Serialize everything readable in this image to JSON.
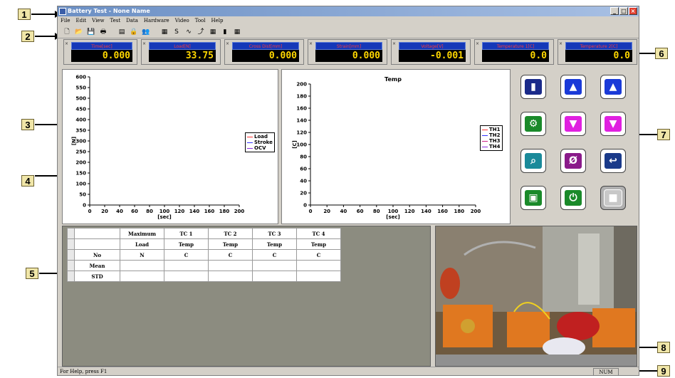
{
  "window": {
    "title": "Battery Test - None Name"
  },
  "menu": [
    "File",
    "Edit",
    "View",
    "Test",
    "Data",
    "Hardware",
    "Video",
    "Tool",
    "Help"
  ],
  "toolbar": [
    "new-icon",
    "open-icon",
    "save-icon",
    "print-icon",
    "table-icon",
    "lock-icon",
    "people-icon",
    "chart-icon",
    "s-icon",
    "curve-icon",
    "curve2-icon",
    "grid-icon",
    "bar-icon",
    "calendar-icon"
  ],
  "meters": [
    {
      "label": "Time[sec]",
      "value": "0.000"
    },
    {
      "label": "Load[N]",
      "value": "33.75"
    },
    {
      "label": "Cross Dist[mm]",
      "value": "0.000"
    },
    {
      "label": "Strain[mm]",
      "value": "0.000"
    },
    {
      "label": "Voltage[V]",
      "value": "-0.001"
    },
    {
      "label": "Temperature 1[C]",
      "value": "0.0"
    },
    {
      "label": "Temperature 2[C]",
      "value": "0.0"
    }
  ],
  "chart_data": [
    {
      "type": "line",
      "title": "",
      "xlabel": "[sec]",
      "ylabel": "[N]",
      "xlim": [
        0,
        200
      ],
      "ylim": [
        0,
        600
      ],
      "x_ticks": [
        0,
        20,
        40,
        60,
        80,
        100,
        120,
        140,
        160,
        180,
        200
      ],
      "y_ticks": [
        0,
        50,
        100,
        150,
        200,
        250,
        300,
        350,
        400,
        450,
        500,
        550,
        600
      ],
      "series": [
        {
          "name": "Load",
          "color": "#ff3333",
          "values": []
        },
        {
          "name": "Stroke",
          "color": "#3333ff",
          "values": []
        },
        {
          "name": "OCV",
          "color": "#8a2be2",
          "values": []
        }
      ],
      "legend": "right"
    },
    {
      "type": "line",
      "title": "Temp",
      "xlabel": "[sec]",
      "ylabel": "[C]",
      "xlim": [
        0,
        200
      ],
      "ylim": [
        0,
        200
      ],
      "x_ticks": [
        0,
        20,
        40,
        60,
        80,
        100,
        120,
        140,
        160,
        180,
        200
      ],
      "y_ticks": [
        0,
        20,
        40,
        60,
        80,
        100,
        120,
        140,
        160,
        180,
        200
      ],
      "series": [
        {
          "name": "TH1",
          "color": "#ff3333",
          "values": []
        },
        {
          "name": "TH2",
          "color": "#3333ff",
          "values": []
        },
        {
          "name": "TH3",
          "color": "#cc2288",
          "values": []
        },
        {
          "name": "TH4",
          "color": "#8a2be2",
          "values": []
        }
      ],
      "legend": "right"
    }
  ],
  "controls": [
    {
      "name": "battery-button",
      "bg": "#1a2a8a",
      "glyph": "▮"
    },
    {
      "name": "up-button",
      "bg": "#1a3ad8",
      "glyph": "▲"
    },
    {
      "name": "fast-up-button",
      "bg": "#1a3ad8",
      "glyph": "▲"
    },
    {
      "name": "settings-button",
      "bg": "#1a8a2a",
      "glyph": "⚙"
    },
    {
      "name": "down-button",
      "bg": "#e020e0",
      "glyph": "▼"
    },
    {
      "name": "fast-down-button",
      "bg": "#e020e0",
      "glyph": "▼"
    },
    {
      "name": "zoom-button",
      "bg": "#1a8a9a",
      "glyph": "⌕"
    },
    {
      "name": "zero-button",
      "bg": "#8a1a8a",
      "glyph": "Ø"
    },
    {
      "name": "return-button",
      "bg": "#1a3a8a",
      "glyph": "↩"
    },
    {
      "name": "record-button",
      "bg": "#1a8a2a",
      "glyph": "▣"
    },
    {
      "name": "power-button",
      "bg": "#1a8a2a",
      "glyph": "⏻"
    },
    {
      "name": "stop-button",
      "bg": "#c8c8c8",
      "glyph": "■"
    }
  ],
  "stats_table": {
    "headers": [
      "Maximum",
      "TC 1",
      "TC 2",
      "TC 3",
      "TC 4"
    ],
    "subheaders": [
      "Load",
      "Temp",
      "Temp",
      "Temp",
      "Temp"
    ],
    "units_label": "No",
    "units": [
      "N",
      "C",
      "C",
      "C",
      "C"
    ],
    "rows": [
      {
        "label": "Mean",
        "values": [
          "",
          "",
          "",
          "",
          ""
        ]
      },
      {
        "label": "STD",
        "values": [
          "",
          "",
          "",
          "",
          ""
        ]
      }
    ]
  },
  "status": {
    "help": "For Help, press F1",
    "num": "NUM"
  },
  "callouts": [
    "1",
    "2",
    "3",
    "4",
    "5",
    "6",
    "7",
    "8",
    "9"
  ]
}
